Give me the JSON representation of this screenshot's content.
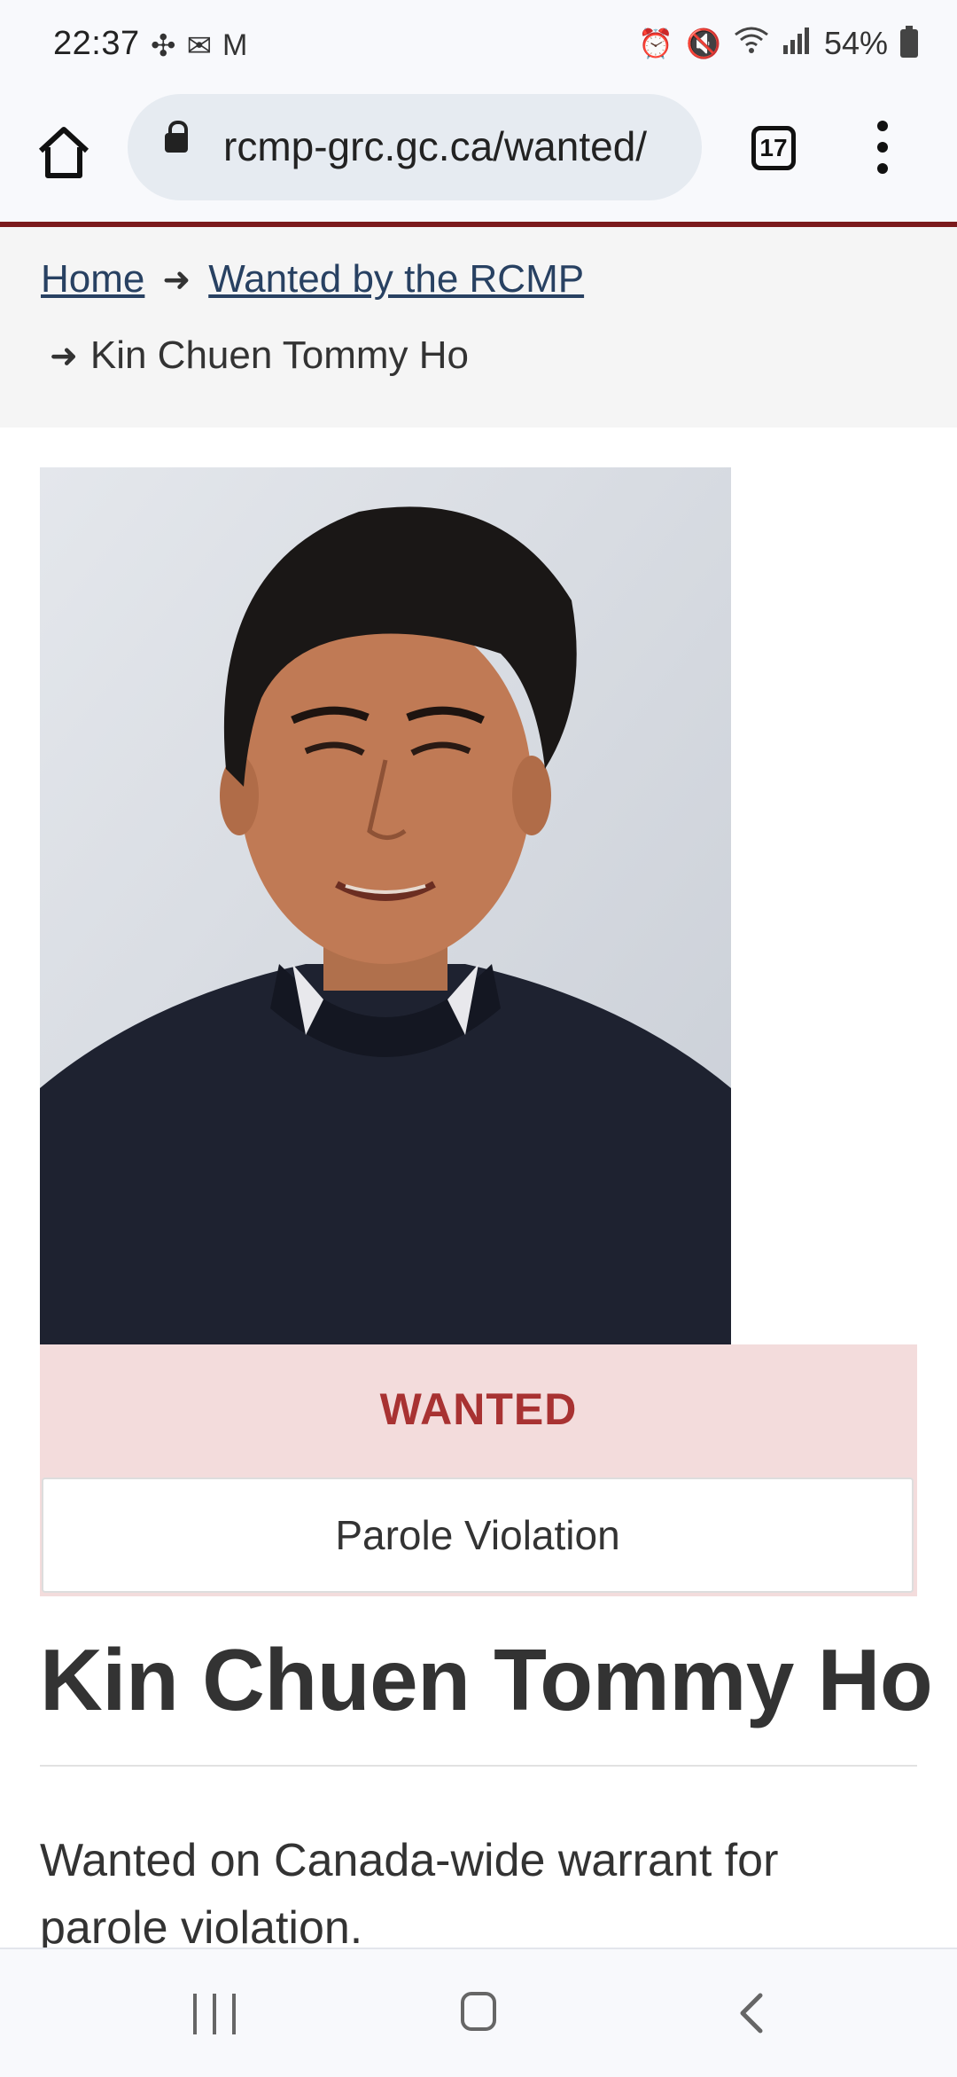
{
  "status_bar": {
    "time": "22:37",
    "left_icons": [
      "fan-icon",
      "outlook-icon",
      "gmail-icon"
    ],
    "right_icons": [
      "alarm-icon",
      "mute-icon",
      "wifi-icon",
      "signal-icon"
    ],
    "battery": "54%"
  },
  "browser": {
    "url": "rcmp-grc.gc.ca/wanted/",
    "tab_count": "17"
  },
  "breadcrumb": {
    "items": [
      {
        "label": "Home"
      },
      {
        "label": "Wanted by the RCMP"
      }
    ],
    "current": "Kin Chuen Tommy Ho"
  },
  "notice": {
    "status": "WANTED",
    "reason": "Parole Violation"
  },
  "main": {
    "title": "Kin Chuen Tommy Ho",
    "description": "Wanted on Canada-wide warrant for parole violation."
  },
  "colors": {
    "accent_red": "#7b1a1c",
    "wanted_red": "#a83232",
    "wanted_bg": "#f3dcdc",
    "link_blue": "#284162"
  }
}
